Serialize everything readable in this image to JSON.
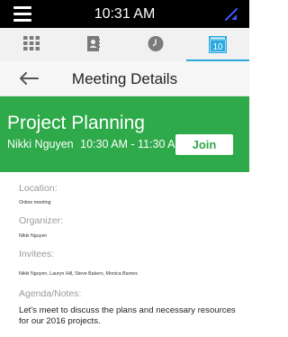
{
  "status": {
    "time": "10:31 AM",
    "calendar_day": "10"
  },
  "tabs": [
    {
      "name": "apps"
    },
    {
      "name": "contacts"
    },
    {
      "name": "recent"
    },
    {
      "name": "calendar"
    }
  ],
  "header": {
    "title": "Meeting Details"
  },
  "meeting": {
    "title": "Project Planning",
    "organizer_name": "Nikki Nguyen",
    "time_range": "10:30 AM - 11:30 AM",
    "join_label": "Join"
  },
  "details": {
    "location_label": "Location:",
    "location_value": "Online meeting",
    "organizer_label": "Organizer:",
    "organizer_value": "Nikki Nguyen",
    "invitees_label": "Invitees:",
    "invitees_value": "Nikki Nguyen, Lauryn Hill, Steve Bakers, Monica Barnes",
    "agenda_label": "Agenda/Notes:",
    "agenda_value": "Let's meet to discuss the plans and necessary resources for our 2016 projects."
  },
  "colors": {
    "accent_green": "#2eaa4a",
    "tab_blue": "#29a9e0"
  }
}
